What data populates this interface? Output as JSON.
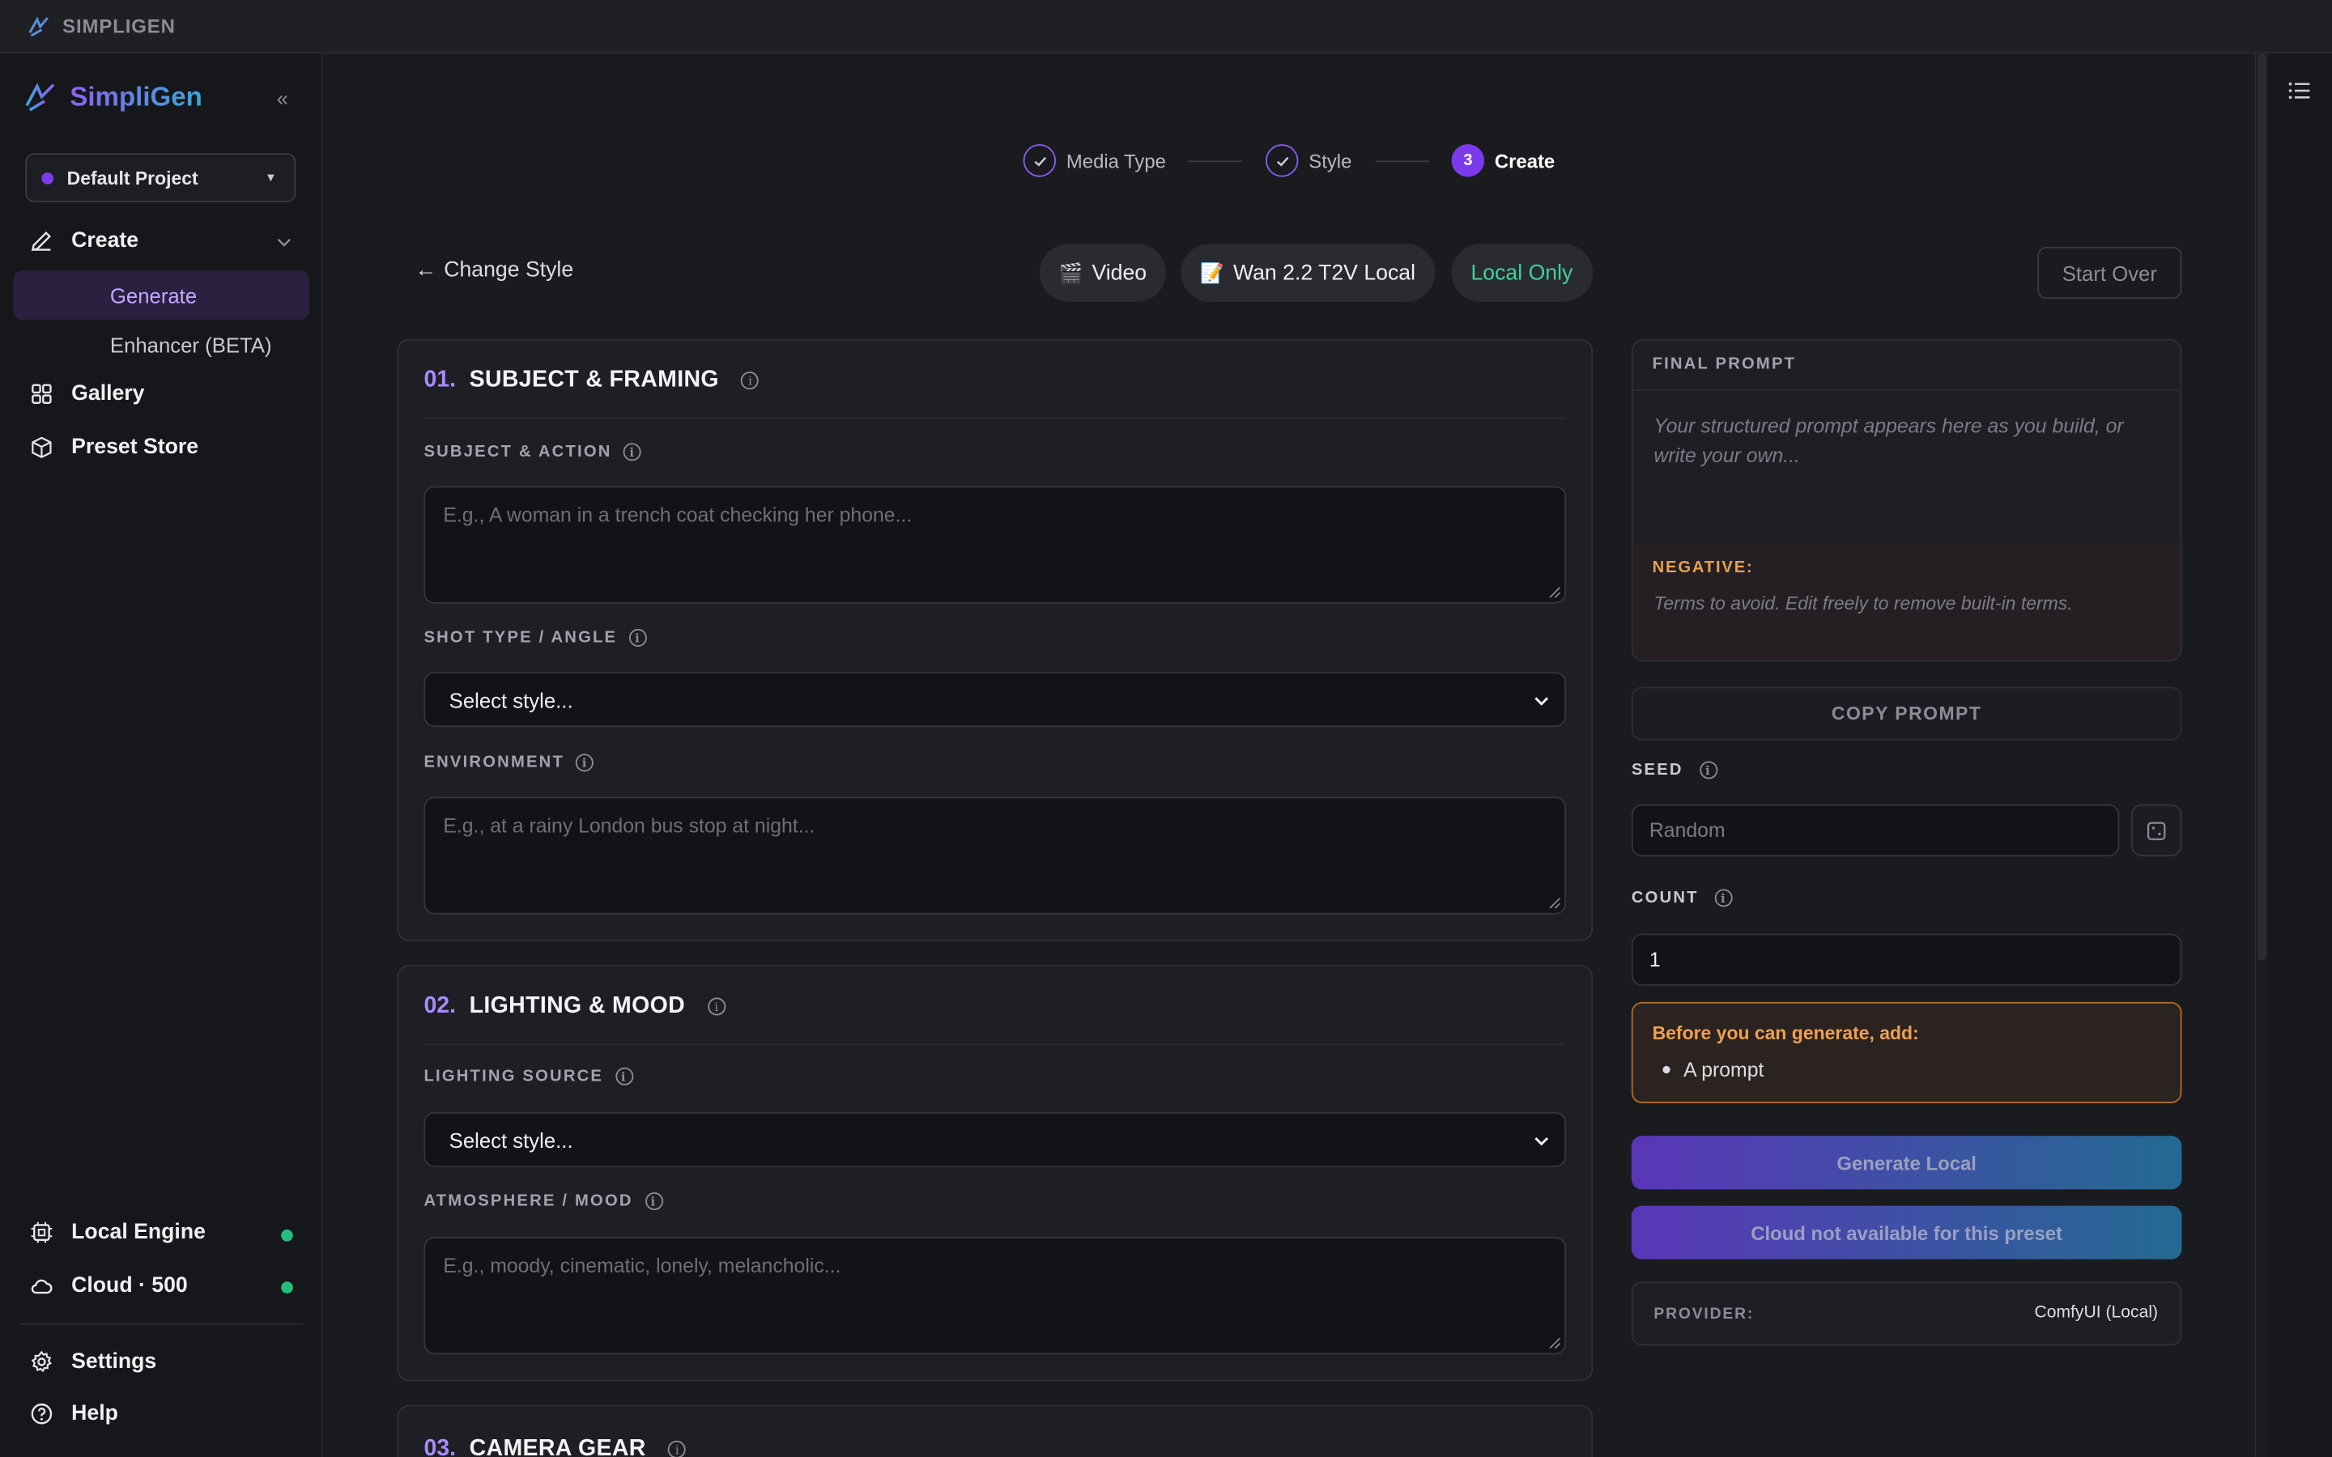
{
  "titlebar": {
    "title": "SIMPLIGEN"
  },
  "sidebar": {
    "brand": "SimpliGen",
    "collapse_glyph": "«",
    "project": "Default Project",
    "nav": {
      "create": "Create",
      "generate": "Generate",
      "enhancer": "Enhancer (BETA)",
      "gallery": "Gallery",
      "preset_store": "Preset Store",
      "local_engine": "Local Engine",
      "cloud": "Cloud · 500",
      "settings": "Settings",
      "help": "Help"
    },
    "status_colors": {
      "online": "#22c07a"
    }
  },
  "stepper": {
    "steps": [
      {
        "label": "Media Type",
        "state": "done"
      },
      {
        "label": "Style",
        "state": "done"
      },
      {
        "label": "Create",
        "state": "current",
        "number": "3"
      }
    ]
  },
  "toolbar": {
    "back": "Change Style",
    "chips": [
      {
        "emoji": "🎬",
        "label": "Video"
      },
      {
        "emoji": "📝",
        "label": "Wan 2.2 T2V Local"
      },
      {
        "label": "Local Only"
      }
    ],
    "start_over": "Start Over"
  },
  "sections": [
    {
      "number": "01.",
      "title": "SUBJECT & FRAMING",
      "fields": {
        "subject_label": "SUBJECT & ACTION",
        "subject_placeholder": "E.g., A woman in a trench coat checking her phone...",
        "shot_label": "SHOT TYPE / ANGLE",
        "shot_value": "Select style...",
        "env_label": "ENVIRONMENT",
        "env_placeholder": "E.g., at a rainy London bus stop at night..."
      }
    },
    {
      "number": "02.",
      "title": "LIGHTING & MOOD",
      "fields": {
        "light_label": "LIGHTING SOURCE",
        "light_value": "Select style...",
        "mood_label": "ATMOSPHERE / MOOD",
        "mood_placeholder": "E.g., moody, cinematic, lonely, melancholic..."
      }
    },
    {
      "number": "03.",
      "title": "CAMERA GEAR"
    }
  ],
  "final_prompt": {
    "title": "FINAL PROMPT",
    "placeholder": "Your structured prompt appears here as you build, or write your own...",
    "negative_label": "NEGATIVE:",
    "negative_placeholder": "Terms to avoid. Edit freely to remove built-in terms.",
    "copy": "COPY PROMPT"
  },
  "seed": {
    "label": "SEED",
    "placeholder": "Random"
  },
  "count": {
    "label": "COUNT",
    "value": "1"
  },
  "warning": {
    "title": "Before you can generate, add:",
    "items": [
      "A prompt"
    ]
  },
  "buttons": {
    "generate_local": "Generate Local",
    "cloud": "Cloud not available for this preset"
  },
  "provider": {
    "label": "PROVIDER:",
    "value": "ComfyUI (Local)"
  },
  "colors": {
    "accent": "#7c3aed",
    "warning": "#f0a050",
    "local_only": "#3fd39a"
  }
}
